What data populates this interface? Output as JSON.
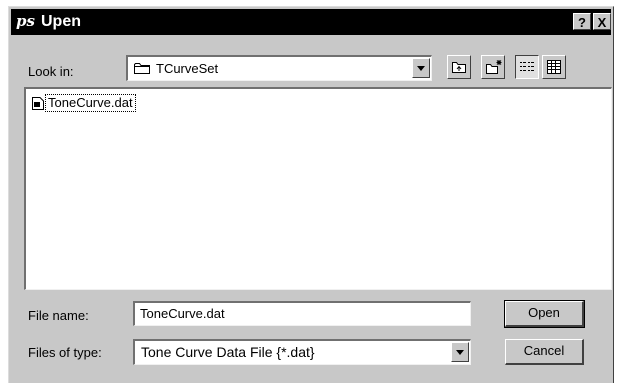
{
  "window": {
    "title": "Upen",
    "app_icon_text": "ps",
    "help_label": "?",
    "close_label": "X"
  },
  "lookin": {
    "label": "Look in:",
    "folder": "TCurveSet"
  },
  "toolbar": [
    {
      "name": "up-one-level-icon"
    },
    {
      "name": "new-folder-icon"
    },
    {
      "name": "list-view-icon"
    },
    {
      "name": "details-view-icon"
    }
  ],
  "files": [
    {
      "name": "ToneCurve.dat"
    }
  ],
  "file_name": {
    "label": "File name:",
    "value": "ToneCurve.dat"
  },
  "file_type": {
    "label": "Files of type:",
    "value": "Tone Curve Data File {*.dat}"
  },
  "buttons": {
    "open": "Open",
    "cancel": "Cancel"
  }
}
